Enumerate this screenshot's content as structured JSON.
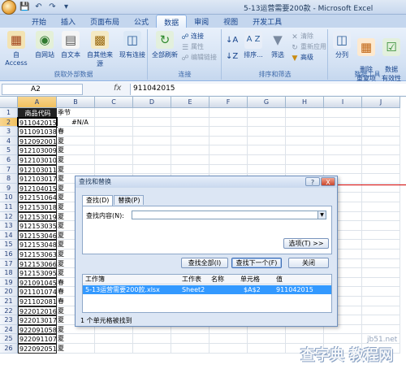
{
  "window": {
    "title": "5-13运营需要200款 - Microsoft Excel"
  },
  "quick_access": [
    "save-icon",
    "undo-icon",
    "redo-icon",
    "dropdown-icon"
  ],
  "ribbon": {
    "tabs": [
      "开始",
      "插入",
      "页面布局",
      "公式",
      "数据",
      "审阅",
      "视图",
      "开发工具"
    ],
    "active_tab": "数据",
    "groups": {
      "external": {
        "label": "获取外部数据",
        "buttons": [
          "自 Access",
          "自网站",
          "自文本",
          "自其他来源",
          "现有连接"
        ]
      },
      "connections": {
        "label": "连接",
        "refresh": "全部刷新",
        "items": [
          "连接",
          "属性",
          "编辑链接"
        ]
      },
      "sort_filter": {
        "label": "排序和筛选",
        "sort": "排序...",
        "filter": "筛选",
        "items": [
          "清除",
          "重新应用",
          "高级"
        ]
      },
      "tools": {
        "label": "数据工具",
        "buttons": [
          "分列",
          "删除\n重复项",
          "数据\n有效性"
        ]
      }
    }
  },
  "formula_bar": {
    "name_box": "A2",
    "fx": "fx",
    "value": "911042015"
  },
  "sheet": {
    "columns": [
      "A",
      "B",
      "C",
      "D",
      "E",
      "F",
      "G",
      "H",
      "I",
      "J"
    ],
    "rows": [
      {
        "n": "1",
        "a": "商品代码",
        "b": "季节"
      },
      {
        "n": "2",
        "a": "911042015",
        "b": "#N/A"
      },
      {
        "n": "3",
        "a": "911091038",
        "b": "春"
      },
      {
        "n": "4",
        "a": "912092001",
        "b": "夏"
      },
      {
        "n": "5",
        "a": "912103009",
        "b": "夏"
      },
      {
        "n": "6",
        "a": "912103010",
        "b": "夏"
      },
      {
        "n": "7",
        "a": "912103011",
        "b": "夏"
      },
      {
        "n": "8",
        "a": "912103017",
        "b": "夏"
      },
      {
        "n": "9",
        "a": "912104015",
        "b": "夏"
      },
      {
        "n": "10",
        "a": "912151064",
        "b": "夏"
      },
      {
        "n": "11",
        "a": "912153018",
        "b": "夏"
      },
      {
        "n": "12",
        "a": "912153019",
        "b": "夏"
      },
      {
        "n": "13",
        "a": "912153035",
        "b": "夏"
      },
      {
        "n": "14",
        "a": "912153046",
        "b": "夏"
      },
      {
        "n": "15",
        "a": "912153048",
        "b": "夏"
      },
      {
        "n": "16",
        "a": "912153063",
        "b": "夏"
      },
      {
        "n": "17",
        "a": "912153066",
        "b": "夏"
      },
      {
        "n": "18",
        "a": "912153095",
        "b": "夏"
      },
      {
        "n": "19",
        "a": "921091045",
        "b": "春"
      },
      {
        "n": "20",
        "a": "921101074",
        "b": "春"
      },
      {
        "n": "21",
        "a": "921102081",
        "b": "春"
      },
      {
        "n": "22",
        "a": "922012016",
        "b": "夏"
      },
      {
        "n": "23",
        "a": "922013017",
        "b": "夏"
      },
      {
        "n": "24",
        "a": "922091058",
        "b": "夏"
      },
      {
        "n": "25",
        "a": "922091107",
        "b": "夏"
      },
      {
        "n": "26",
        "a": "922092051",
        "b": "夏"
      }
    ]
  },
  "dialog": {
    "title": "查找和替换",
    "help": "?",
    "close": "X",
    "tabs": [
      "查找(D)",
      "替换(P)"
    ],
    "find_label": "查找内容(N):",
    "find_value": "",
    "options_button": "选项(T) >>",
    "find_all_button": "查找全部(I)",
    "find_next_button": "查找下一个(F)",
    "close_button": "关闭",
    "result_headers": [
      "工作簿",
      "工作表",
      "名称",
      "单元格",
      "值"
    ],
    "result_row": {
      "workbook": "5-13运营需要200款.xlsx",
      "sheet": "Sheet2",
      "name": "",
      "cell": "$A$2",
      "value": "911042015"
    },
    "status": "1 个单元格被找到"
  },
  "watermark": {
    "line1": "jb51.net",
    "line2": "查字典 教程网"
  }
}
